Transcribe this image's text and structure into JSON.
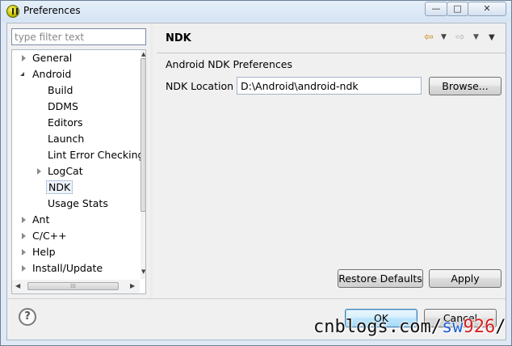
{
  "window": {
    "title": "Preferences",
    "controls": {
      "minimize": "—",
      "maximize": "□",
      "close": "✕"
    }
  },
  "filter": {
    "placeholder": "type filter text",
    "value": ""
  },
  "tree": {
    "items": [
      {
        "label": "General",
        "twisty": "closed"
      },
      {
        "label": "Android",
        "twisty": "open"
      },
      {
        "label": "Build"
      },
      {
        "label": "DDMS"
      },
      {
        "label": "Editors"
      },
      {
        "label": "Launch"
      },
      {
        "label": "Lint Error Checking"
      },
      {
        "label": "LogCat",
        "twisty": "closed"
      },
      {
        "label": "NDK",
        "selected": true
      },
      {
        "label": "Usage Stats"
      },
      {
        "label": "Ant",
        "twisty": "closed"
      },
      {
        "label": "C/C++",
        "twisty": "closed"
      },
      {
        "label": "Help",
        "twisty": "closed"
      },
      {
        "label": "Install/Update",
        "twisty": "closed"
      }
    ],
    "hscroll_grip": "⁞⁞⁞"
  },
  "page": {
    "title": "NDK",
    "description": "Android NDK Preferences",
    "ndk_location_label": "NDK Location",
    "ndk_location_value": "D:\\Android\\android-ndk",
    "browse_label": "Browse...",
    "restore_defaults_label": "Restore Defaults",
    "apply_label": "Apply"
  },
  "nav": {
    "back_icon": "⇦",
    "forward_icon": "⇨",
    "menu_icon": "▼"
  },
  "dialog": {
    "help_icon": "?",
    "ok_label": "OK",
    "cancel_label": "Cancel"
  },
  "watermark": {
    "part1": "cnblogs.com/",
    "part2": "sw",
    "part3": "926",
    "part4": "/"
  },
  "colors": {
    "titlebar": "#dfe9f5",
    "dialog_bg": "#f0f0f0",
    "selection_border": "#7e9bc2"
  }
}
